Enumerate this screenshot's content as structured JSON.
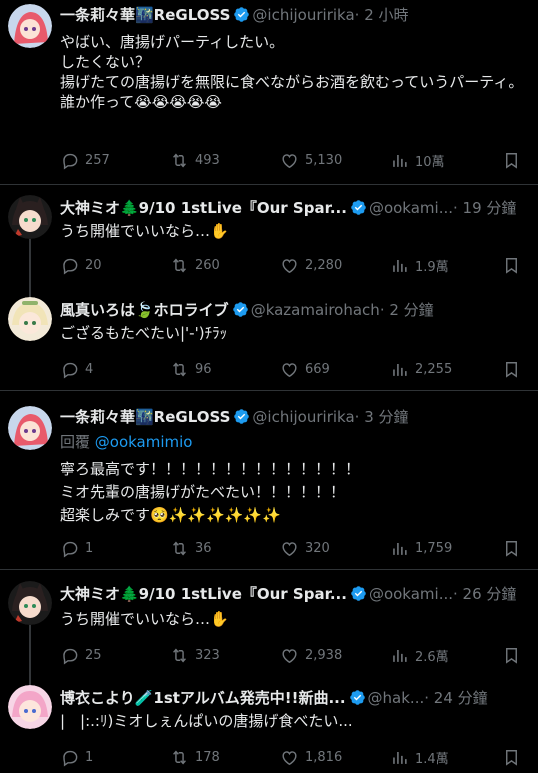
{
  "tweets": [
    {
      "name": "一条莉々華🌃ReGLOSS",
      "handle": "@ichijouririka",
      "time": "· 2 小時",
      "text": "やばい、唐揚げパーティしたい。\nしたくない？\n揚げたての唐揚げを無限に食べながらお酒を飲むっていうパーティ。\n誰か作って😭😭😭😭😭",
      "replies": "257",
      "retweets": "493",
      "likes": "5,130",
      "views": "10萬",
      "avatar_color": "#e85a6b"
    },
    {
      "name": "大神ミオ🌲9/10 1stLive『Our Spar...",
      "handle": "@ookami...",
      "time": "· 19 分鐘",
      "text": "うち開催でいいなら…✋",
      "replies": "20",
      "retweets": "260",
      "likes": "2,280",
      "views": "1.9萬",
      "avatar_color": "#3b2a2a"
    },
    {
      "name": "風真いろは🍃ホロライブ",
      "handle": "@kazamairohach",
      "time": "· 2 分鐘",
      "text": "ござるもたべたい|'-')ﾁﾗｯ",
      "replies": "4",
      "retweets": "96",
      "likes": "669",
      "views": "2,255",
      "avatar_color": "#f0e2c2"
    },
    {
      "name": "一条莉々華🌃ReGLOSS",
      "handle": "@ichijouririka",
      "time": "· 3 分鐘",
      "reply_prefix": "回覆 ",
      "reply_to": "@ookamimio",
      "text": "寧ろ最高です！！！！！！！！！！！！！！\nミオ先輩の唐揚げがたべたい！！！！！！\n超楽しみです🥺✨✨✨✨✨✨",
      "replies": "1",
      "retweets": "36",
      "likes": "320",
      "views": "1,759",
      "avatar_color": "#e85a6b"
    },
    {
      "name": "大神ミオ🌲9/10 1stLive『Our Spar...",
      "handle": "@ookami...",
      "time": "· 26 分鐘",
      "text": "うち開催でいいなら…✋",
      "replies": "25",
      "retweets": "323",
      "likes": "2,938",
      "views": "2.6萬",
      "avatar_color": "#3b2a2a"
    },
    {
      "name": "博衣こより🧪1stアルバム発売中!!新曲...",
      "handle": "@hak...",
      "time": "· 24 分鐘",
      "text": "|　|:.:ﾘ)ミオしぇんぱいの唐揚げ食べたい...",
      "replies": "1",
      "retweets": "178",
      "likes": "1,816",
      "views": "1.4萬",
      "avatar_color": "#f3a6c8"
    }
  ],
  "colors": {
    "verified": "#1d9bf0",
    "muted": "#71767b",
    "link": "#1d9bf0"
  },
  "icons": [
    "reply-icon",
    "retweet-icon",
    "like-icon",
    "views-icon",
    "bookmark-icon",
    "verified-badge-icon"
  ]
}
